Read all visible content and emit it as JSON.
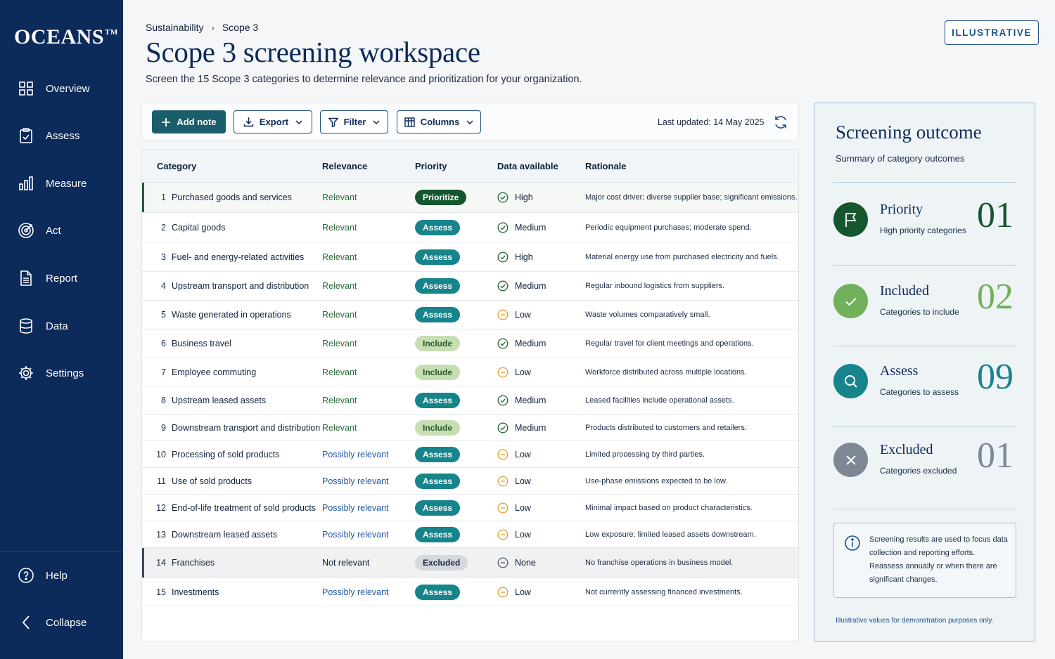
{
  "app": {
    "logo": "OCEANS",
    "logo_mark": "TM"
  },
  "nav": {
    "items": [
      {
        "label": "Overview",
        "icon": "grid-icon"
      },
      {
        "label": "Assess",
        "icon": "clipboard-check-icon"
      },
      {
        "label": "Measure",
        "icon": "bar-chart-icon"
      },
      {
        "label": "Act",
        "icon": "target-icon"
      },
      {
        "label": "Report",
        "icon": "document-icon"
      },
      {
        "label": "Data",
        "icon": "database-icon"
      },
      {
        "label": "Settings",
        "icon": "gear-icon"
      }
    ],
    "help": "Help",
    "collapse": "Collapse"
  },
  "breadcrumb": {
    "parent": "Sustainability",
    "current": "Scope 3"
  },
  "header": {
    "title": "Scope 3 screening workspace",
    "subtitle": "Screen the 15 Scope 3 categories to determine relevance and prioritization for your organization.",
    "badge": "ILLUSTRATIVE"
  },
  "toolbar": {
    "add_note": "Add note",
    "export": "Export",
    "filter": "Filter",
    "columns": "Columns",
    "last_updated": "Last updated: 14 May 2025"
  },
  "table": {
    "columns": [
      "Category",
      "Relevance",
      "Priority",
      "Data available",
      "Rationale"
    ],
    "rows": [
      {
        "num": "1",
        "category": "Purchased goods and services",
        "relevance": "Relevant",
        "priority": "Prioritize",
        "data": "High",
        "rationale": "Major cost driver; diverse supplier base; significant emissions."
      },
      {
        "num": "2",
        "category": "Capital goods",
        "relevance": "Relevant",
        "priority": "Assess",
        "data": "Medium",
        "rationale": "Periodic equipment purchases; moderate spend."
      },
      {
        "num": "3",
        "category": "Fuel- and energy-related activities",
        "relevance": "Relevant",
        "priority": "Assess",
        "data": "High",
        "rationale": "Material energy use from purchased electricity and fuels."
      },
      {
        "num": "4",
        "category": "Upstream transport and distribution",
        "relevance": "Relevant",
        "priority": "Assess",
        "data": "Medium",
        "rationale": "Regular inbound logistics from suppliers."
      },
      {
        "num": "5",
        "category": "Waste generated in operations",
        "relevance": "Relevant",
        "priority": "Assess",
        "data": "Low",
        "rationale": "Waste volumes comparatively small."
      },
      {
        "num": "6",
        "category": "Business travel",
        "relevance": "Relevant",
        "priority": "Include",
        "data": "Medium",
        "rationale": "Regular travel for client meetings and operations."
      },
      {
        "num": "7",
        "category": "Employee commuting",
        "relevance": "Relevant",
        "priority": "Include",
        "data": "Low",
        "rationale": "Workforce distributed across multiple locations."
      },
      {
        "num": "8",
        "category": "Upstream leased assets",
        "relevance": "Relevant",
        "priority": "Assess",
        "data": "Medium",
        "rationale": "Leased facilities include operational assets."
      },
      {
        "num": "9",
        "category": "Downstream transport and distribution",
        "relevance": "Relevant",
        "priority": "Include",
        "data": "Medium",
        "rationale": "Products distributed to customers and retailers."
      },
      {
        "num": "10",
        "category": "Processing of sold products",
        "relevance": "Possibly relevant",
        "priority": "Assess",
        "data": "Low",
        "rationale": "Limited processing by third parties."
      },
      {
        "num": "11",
        "category": "Use of sold products",
        "relevance": "Possibly relevant",
        "priority": "Assess",
        "data": "Low",
        "rationale": "Use-phase emissions expected to be low."
      },
      {
        "num": "12",
        "category": "End-of-life treatment of sold products",
        "relevance": "Possibly relevant",
        "priority": "Assess",
        "data": "Low",
        "rationale": "Minimal impact based on product characteristics."
      },
      {
        "num": "13",
        "category": "Downstream leased assets",
        "relevance": "Possibly relevant",
        "priority": "Assess",
        "data": "Low",
        "rationale": "Low exposure; limited leased assets downstream."
      },
      {
        "num": "14",
        "category": "Franchises",
        "relevance": "Not relevant",
        "priority": "Excluded",
        "data": "None",
        "rationale": "No franchise operations in business model."
      },
      {
        "num": "15",
        "category": "Investments",
        "relevance": "Possibly relevant",
        "priority": "Assess",
        "data": "Low",
        "rationale": "Not currently assessing financed investments."
      }
    ]
  },
  "panel": {
    "title": "Screening outcome",
    "subtitle": "Summary of category outcomes",
    "outcomes": [
      {
        "name": "Priority",
        "desc": "High priority categories",
        "count": "01",
        "color": "#15562f",
        "icon": "flag-icon"
      },
      {
        "name": "Included",
        "desc": "Categories to include",
        "count": "02",
        "color": "#72b05a",
        "icon": "check-icon"
      },
      {
        "name": "Assess",
        "desc": "Categories to assess",
        "count": "09",
        "color": "#17848c",
        "icon": "search-icon"
      },
      {
        "name": "Excluded",
        "desc": "Categories excluded",
        "count": "01",
        "color": "#7d8894",
        "icon": "close-icon"
      }
    ],
    "info": "Screening results are used to focus data collection and reporting efforts. Reassess annually or when there are significant changes.",
    "footnote": "Illustrative values for demonstration purposes only."
  }
}
